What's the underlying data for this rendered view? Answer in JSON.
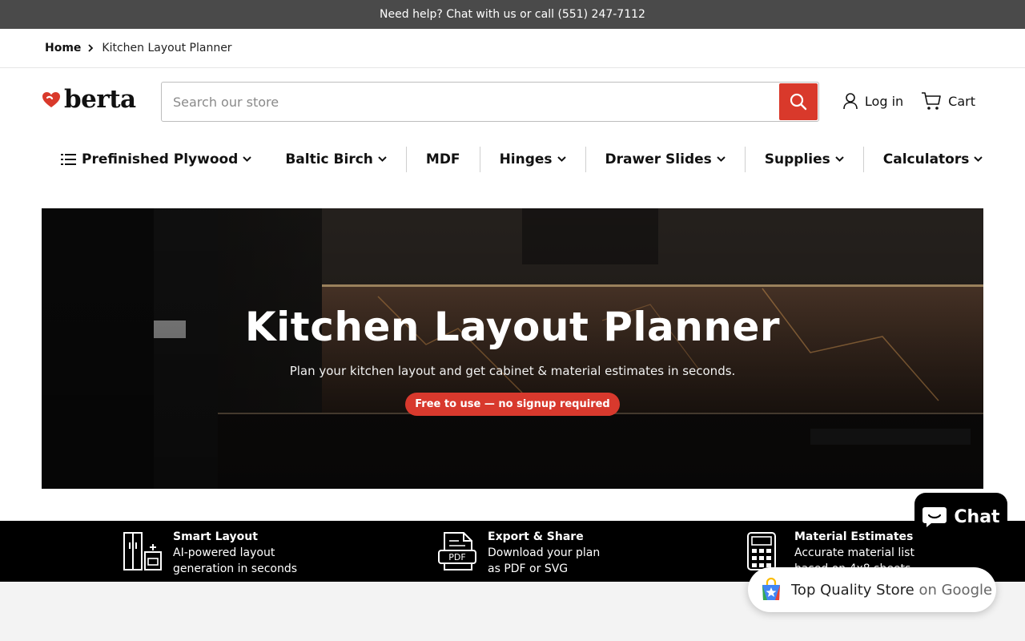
{
  "announcement": "Need help? Chat with us or call (551) 247-7112",
  "breadcrumb": {
    "home": "Home",
    "current": "Kitchen Layout Planner"
  },
  "brand": {
    "name": "berta",
    "accent": "#d9392b"
  },
  "search": {
    "placeholder": "Search our store",
    "icon": "search-icon"
  },
  "header": {
    "login_label": "Log in",
    "cart_label": "Cart"
  },
  "nav": {
    "items": [
      {
        "label": "Prefinished Plywood"
      },
      {
        "label": "Baltic Birch"
      },
      {
        "label": "MDF"
      },
      {
        "label": "Hinges"
      },
      {
        "label": "Drawer Slides"
      },
      {
        "label": "Supplies"
      },
      {
        "label": "Calculators"
      }
    ]
  },
  "hero": {
    "title": "Kitchen Layout Planner",
    "subtitle": "Plan your kitchen layout and get cabinet & material estimates in seconds.",
    "badge": "Free to use — no signup required"
  },
  "features": [
    {
      "title": "Smart Layout",
      "line1": "AI-powered layout",
      "line2": "generation in seconds",
      "icon": "kitchen-layout-icon"
    },
    {
      "title": "Export & Share",
      "line1": "Download your plan",
      "line2": "as PDF or SVG",
      "icon": "pdf-file-icon"
    },
    {
      "title": "Material Estimates",
      "line1": "Accurate material list",
      "line2": "based on 4x8 sheets",
      "icon": "calculator-icon"
    }
  ],
  "chat": {
    "label": "Chat"
  },
  "google_badge": {
    "text": "Top Quality Store",
    "suffix": "on Google"
  }
}
